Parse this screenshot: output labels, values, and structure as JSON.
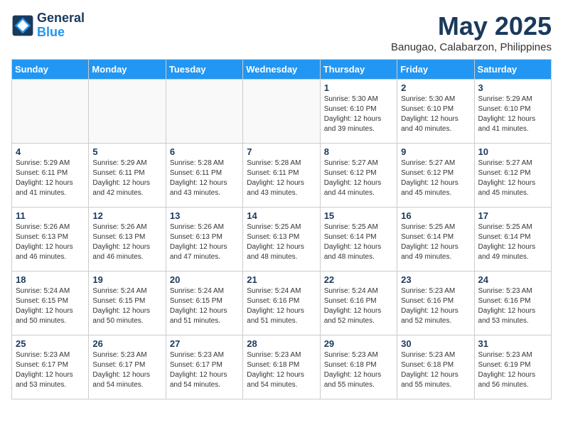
{
  "header": {
    "logo_line1": "General",
    "logo_line2": "Blue",
    "month": "May 2025",
    "location": "Banugao, Calabarzon, Philippines"
  },
  "days_of_week": [
    "Sunday",
    "Monday",
    "Tuesday",
    "Wednesday",
    "Thursday",
    "Friday",
    "Saturday"
  ],
  "weeks": [
    [
      {
        "day": "",
        "info": "",
        "empty": true
      },
      {
        "day": "",
        "info": "",
        "empty": true
      },
      {
        "day": "",
        "info": "",
        "empty": true
      },
      {
        "day": "",
        "info": "",
        "empty": true
      },
      {
        "day": "1",
        "info": "Sunrise: 5:30 AM\nSunset: 6:10 PM\nDaylight: 12 hours\nand 39 minutes."
      },
      {
        "day": "2",
        "info": "Sunrise: 5:30 AM\nSunset: 6:10 PM\nDaylight: 12 hours\nand 40 minutes."
      },
      {
        "day": "3",
        "info": "Sunrise: 5:29 AM\nSunset: 6:10 PM\nDaylight: 12 hours\nand 41 minutes."
      }
    ],
    [
      {
        "day": "4",
        "info": "Sunrise: 5:29 AM\nSunset: 6:11 PM\nDaylight: 12 hours\nand 41 minutes."
      },
      {
        "day": "5",
        "info": "Sunrise: 5:29 AM\nSunset: 6:11 PM\nDaylight: 12 hours\nand 42 minutes."
      },
      {
        "day": "6",
        "info": "Sunrise: 5:28 AM\nSunset: 6:11 PM\nDaylight: 12 hours\nand 43 minutes."
      },
      {
        "day": "7",
        "info": "Sunrise: 5:28 AM\nSunset: 6:11 PM\nDaylight: 12 hours\nand 43 minutes."
      },
      {
        "day": "8",
        "info": "Sunrise: 5:27 AM\nSunset: 6:12 PM\nDaylight: 12 hours\nand 44 minutes."
      },
      {
        "day": "9",
        "info": "Sunrise: 5:27 AM\nSunset: 6:12 PM\nDaylight: 12 hours\nand 45 minutes."
      },
      {
        "day": "10",
        "info": "Sunrise: 5:27 AM\nSunset: 6:12 PM\nDaylight: 12 hours\nand 45 minutes."
      }
    ],
    [
      {
        "day": "11",
        "info": "Sunrise: 5:26 AM\nSunset: 6:13 PM\nDaylight: 12 hours\nand 46 minutes."
      },
      {
        "day": "12",
        "info": "Sunrise: 5:26 AM\nSunset: 6:13 PM\nDaylight: 12 hours\nand 46 minutes."
      },
      {
        "day": "13",
        "info": "Sunrise: 5:26 AM\nSunset: 6:13 PM\nDaylight: 12 hours\nand 47 minutes."
      },
      {
        "day": "14",
        "info": "Sunrise: 5:25 AM\nSunset: 6:13 PM\nDaylight: 12 hours\nand 48 minutes."
      },
      {
        "day": "15",
        "info": "Sunrise: 5:25 AM\nSunset: 6:14 PM\nDaylight: 12 hours\nand 48 minutes."
      },
      {
        "day": "16",
        "info": "Sunrise: 5:25 AM\nSunset: 6:14 PM\nDaylight: 12 hours\nand 49 minutes."
      },
      {
        "day": "17",
        "info": "Sunrise: 5:25 AM\nSunset: 6:14 PM\nDaylight: 12 hours\nand 49 minutes."
      }
    ],
    [
      {
        "day": "18",
        "info": "Sunrise: 5:24 AM\nSunset: 6:15 PM\nDaylight: 12 hours\nand 50 minutes."
      },
      {
        "day": "19",
        "info": "Sunrise: 5:24 AM\nSunset: 6:15 PM\nDaylight: 12 hours\nand 50 minutes."
      },
      {
        "day": "20",
        "info": "Sunrise: 5:24 AM\nSunset: 6:15 PM\nDaylight: 12 hours\nand 51 minutes."
      },
      {
        "day": "21",
        "info": "Sunrise: 5:24 AM\nSunset: 6:16 PM\nDaylight: 12 hours\nand 51 minutes."
      },
      {
        "day": "22",
        "info": "Sunrise: 5:24 AM\nSunset: 6:16 PM\nDaylight: 12 hours\nand 52 minutes."
      },
      {
        "day": "23",
        "info": "Sunrise: 5:23 AM\nSunset: 6:16 PM\nDaylight: 12 hours\nand 52 minutes."
      },
      {
        "day": "24",
        "info": "Sunrise: 5:23 AM\nSunset: 6:16 PM\nDaylight: 12 hours\nand 53 minutes."
      }
    ],
    [
      {
        "day": "25",
        "info": "Sunrise: 5:23 AM\nSunset: 6:17 PM\nDaylight: 12 hours\nand 53 minutes."
      },
      {
        "day": "26",
        "info": "Sunrise: 5:23 AM\nSunset: 6:17 PM\nDaylight: 12 hours\nand 54 minutes."
      },
      {
        "day": "27",
        "info": "Sunrise: 5:23 AM\nSunset: 6:17 PM\nDaylight: 12 hours\nand 54 minutes."
      },
      {
        "day": "28",
        "info": "Sunrise: 5:23 AM\nSunset: 6:18 PM\nDaylight: 12 hours\nand 54 minutes."
      },
      {
        "day": "29",
        "info": "Sunrise: 5:23 AM\nSunset: 6:18 PM\nDaylight: 12 hours\nand 55 minutes."
      },
      {
        "day": "30",
        "info": "Sunrise: 5:23 AM\nSunset: 6:18 PM\nDaylight: 12 hours\nand 55 minutes."
      },
      {
        "day": "31",
        "info": "Sunrise: 5:23 AM\nSunset: 6:19 PM\nDaylight: 12 hours\nand 56 minutes."
      }
    ]
  ]
}
